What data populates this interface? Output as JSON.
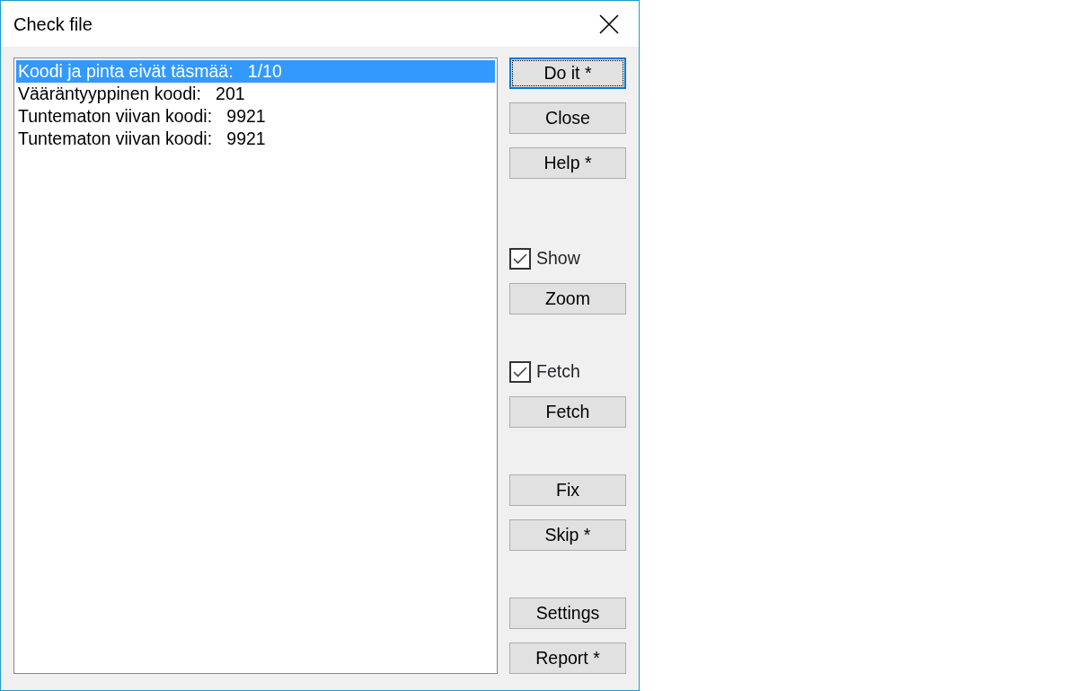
{
  "window": {
    "title": "Check file"
  },
  "list": [
    {
      "text": "Koodi ja pinta eivät täsmää:   1/10",
      "selected": true
    },
    {
      "text": "Vääräntyyppinen koodi:   201",
      "selected": false
    },
    {
      "text": "Tuntematon viivan koodi:   9921",
      "selected": false
    },
    {
      "text": "Tuntematon viivan koodi:   9921",
      "selected": false
    }
  ],
  "control_groups": [
    [
      {
        "kind": "button",
        "label": "Do it *",
        "focused": true
      },
      {
        "kind": "button",
        "label": "Close",
        "focused": false
      },
      {
        "kind": "button",
        "label": "Help *",
        "focused": false
      }
    ],
    [
      {
        "kind": "checkbox",
        "label": "Show",
        "checked": true
      },
      {
        "kind": "button",
        "label": "Zoom",
        "focused": false
      }
    ],
    [
      {
        "kind": "checkbox",
        "label": "Fetch",
        "checked": true
      },
      {
        "kind": "button",
        "label": "Fetch",
        "focused": false
      }
    ],
    [
      {
        "kind": "button",
        "label": "Fix",
        "focused": false
      },
      {
        "kind": "button",
        "label": "Skip *",
        "focused": false
      }
    ],
    [
      {
        "kind": "button",
        "label": "Settings",
        "focused": false
      },
      {
        "kind": "button",
        "label": "Report *",
        "focused": false
      }
    ]
  ]
}
